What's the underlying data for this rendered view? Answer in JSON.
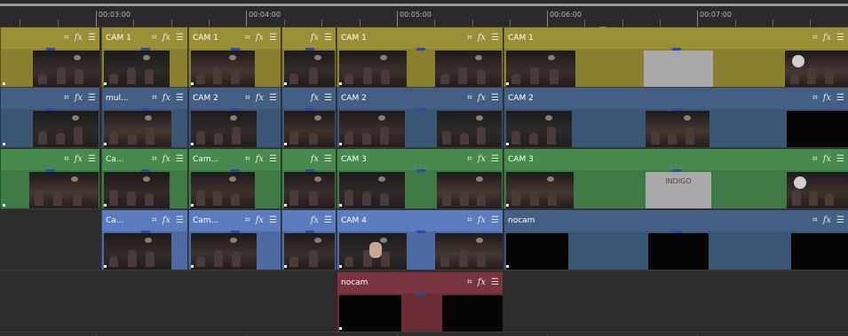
{
  "ruler": {
    "labels": [
      "00:03:00",
      "00:04:00",
      "00:05:00",
      "00:06:00",
      "00:07:00"
    ]
  },
  "colors": {
    "track1": "#8a7f2f",
    "track1_header": "#9b8f35",
    "track2": "#3b5575",
    "track2_header": "#436084",
    "track3": "#3f7a46",
    "track3_header": "#468a4d",
    "track4": "#4e6aa3",
    "track4_header": "#5c7cc0",
    "nocam": "#6a2d36",
    "nocam_header": "#7a3340",
    "empty": "#2e2e2e"
  },
  "icons": {
    "crop": "crop-icon",
    "fx": "fx-icon",
    "menu": "menu-icon"
  },
  "tracks": [
    {
      "track": 1,
      "clips": [
        {
          "name": ""
        },
        {
          "name": "CAM 1"
        },
        {
          "name": "CAM 1"
        },
        {
          "name": ""
        },
        {
          "name": "CAM 1"
        },
        {
          "name": "CAM 1"
        }
      ]
    },
    {
      "track": 2,
      "clips": [
        {
          "name": ""
        },
        {
          "name": "mul..."
        },
        {
          "name": "CAM 2"
        },
        {
          "name": ""
        },
        {
          "name": "CAM 2"
        },
        {
          "name": "CAM 2"
        }
      ]
    },
    {
      "track": 3,
      "clips": [
        {
          "name": ""
        },
        {
          "name": "Ca..."
        },
        {
          "name": "Cam..."
        },
        {
          "name": ""
        },
        {
          "name": "CAM 3"
        },
        {
          "name": "CAM 3"
        }
      ]
    },
    {
      "track": 4,
      "clips": [
        {
          "name": "Ca..."
        },
        {
          "name": "Cam..."
        },
        {
          "name": ""
        },
        {
          "name": "CAM 4"
        },
        {
          "name": "nocam"
        }
      ]
    },
    {
      "track": 5,
      "clips": [
        {
          "name": "nocam"
        }
      ]
    }
  ],
  "thumbnail_text": {
    "indigo": "INDIGO"
  }
}
